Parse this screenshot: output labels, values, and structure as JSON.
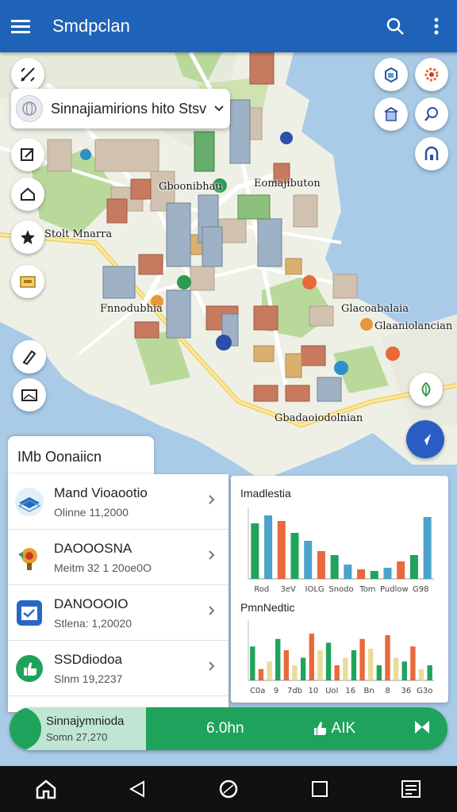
{
  "app": {
    "title": "Smdpclan"
  },
  "search": {
    "value": "Sinnajiamirions hito Stsv"
  },
  "map_labels": {
    "label1": "Gboonibhau",
    "label2": "Eomajibuton",
    "label3": "Stolt Mnarra",
    "label4": "Fnnodubhia",
    "label5": "Glacoabalaia",
    "label6": "Glaaniolancian",
    "label7": "Gbadaoiodolnian"
  },
  "panel": {
    "title": "IMb Oonaiicn",
    "items": [
      {
        "title": "Mand Vioaootio",
        "subtitle": "Olinne 11,2000",
        "icon": "map-layers-icon"
      },
      {
        "title": "DAOOOSNA",
        "subtitle": "Meitm 32 1 20oe0O",
        "icon": "landmark-icon"
      },
      {
        "title": "DANOOOIO",
        "subtitle": "Stlena: 1,20020",
        "icon": "calendar-icon"
      },
      {
        "title": "SSDdiodoa",
        "subtitle": "Slnm 19,2237",
        "icon": "thumbs-up-icon"
      }
    ]
  },
  "charts_panel": {
    "chart1_title": "Imadlestia",
    "chart2_title": "PmnNedtic"
  },
  "chart_data": [
    {
      "type": "bar",
      "title": "Imadlestia",
      "categories": [
        "Rod",
        "3eV",
        "IOLG",
        "Snodo",
        "Tom",
        "Pudlow",
        "G98"
      ],
      "series": [
        {
          "name": "",
          "values": [
            70,
            80,
            73,
            58,
            48,
            35,
            30,
            18,
            12,
            10,
            14,
            22,
            30,
            78
          ]
        }
      ],
      "ylim": [
        0,
        90
      ],
      "colors": [
        "#21a35c",
        "#4aa3c9",
        "#e8693b"
      ]
    },
    {
      "type": "bar",
      "title": "PmnNedtic",
      "categories": [
        "C0a",
        "9",
        "7db",
        "10",
        "UoI",
        "16",
        "Bn",
        "8",
        "36",
        "G3o"
      ],
      "series": [
        {
          "name": "",
          "values": [
            45,
            15,
            25,
            55,
            40,
            20,
            30,
            62,
            40,
            50,
            20,
            30,
            40,
            55,
            42,
            20,
            60,
            30,
            25,
            45,
            15,
            20
          ]
        }
      ],
      "ylim": [
        0,
        80
      ],
      "colors": [
        "#21a35c",
        "#e8693b",
        "#e9dc9a"
      ]
    }
  ],
  "bottom_bar": {
    "current_title": "Sinnajymnioda",
    "current_subtitle": "Somn 27,270",
    "distance": "6.0hn",
    "share_label": "AIK"
  },
  "colors": {
    "primary": "#1f63b8",
    "accent_green": "#1fa35c",
    "water": "#a9cbe8"
  }
}
